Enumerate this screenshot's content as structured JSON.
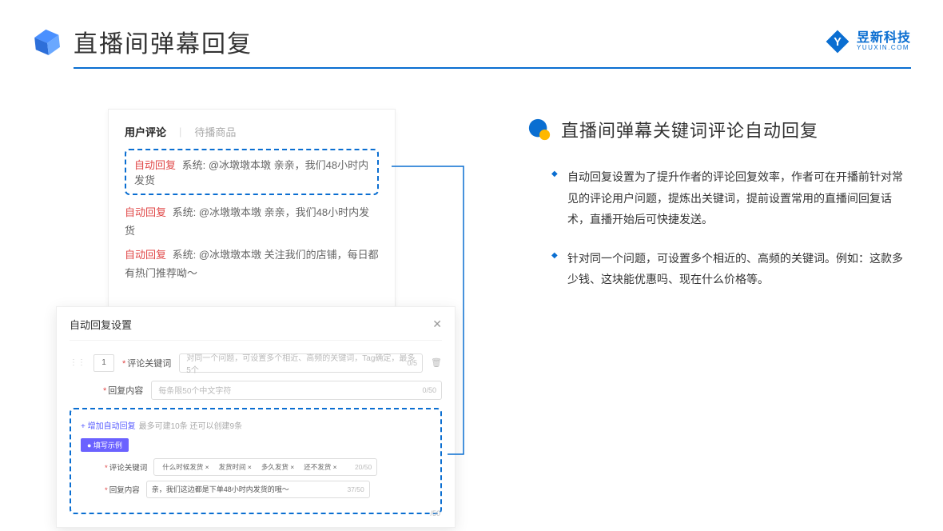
{
  "header": {
    "title": "直播间弹幕回复",
    "logo_cn": "昱新科技",
    "logo_en": "YUUXIN.COM"
  },
  "comments_card": {
    "tab_active": "用户评论",
    "tab_inactive": "待播商品",
    "auto_reply_label": "自动回复",
    "highlighted": "系统: @冰墩墩本墩 亲亲，我们48小时内发货",
    "row2": "系统: @冰墩墩本墩 亲亲，我们48小时内发货",
    "row3": "系统: @冰墩墩本墩 关注我们的店铺，每日都有热门推荐呦～"
  },
  "modal": {
    "title": "自动回复设置",
    "order_value": "1",
    "kw_label": "评论关键词",
    "kw_placeholder": "对同一个问题，可设置多个相近、高频的关键词，Tag确定，最多5个",
    "kw_count": "0/5",
    "content_label": "回复内容",
    "content_placeholder": "每条限50个中文字符",
    "content_count": "0/50",
    "add_link": "+ 增加自动回复",
    "add_hint": "最多可建10条 还可以创建9条",
    "example_badge": "● 填写示例",
    "ex_kw_label": "评论关键词",
    "ex_tags": [
      "什么时候发货 ×",
      "发货时间 ×",
      "多久发货 ×",
      "还不发货 ×"
    ],
    "ex_kw_count": "20/50",
    "ex_content_label": "回复内容",
    "ex_content_value": "亲，我们这边都是下单48小时内发货的哦～",
    "ex_content_count": "37/50",
    "bottom_count": "/50"
  },
  "right": {
    "subtitle": "直播间弹幕关键词评论自动回复",
    "bullets": [
      "自动回复设置为了提升作者的评论回复效率，作者可在开播前针对常见的评论用户问题，提炼出关键词，提前设置常用的直播间回复话术，直播开始后可快捷发送。",
      "针对同一个问题，可设置多个相近的、高频的关键词。例如：这款多少钱、这块能优惠吗、现在什么价格等。"
    ]
  }
}
